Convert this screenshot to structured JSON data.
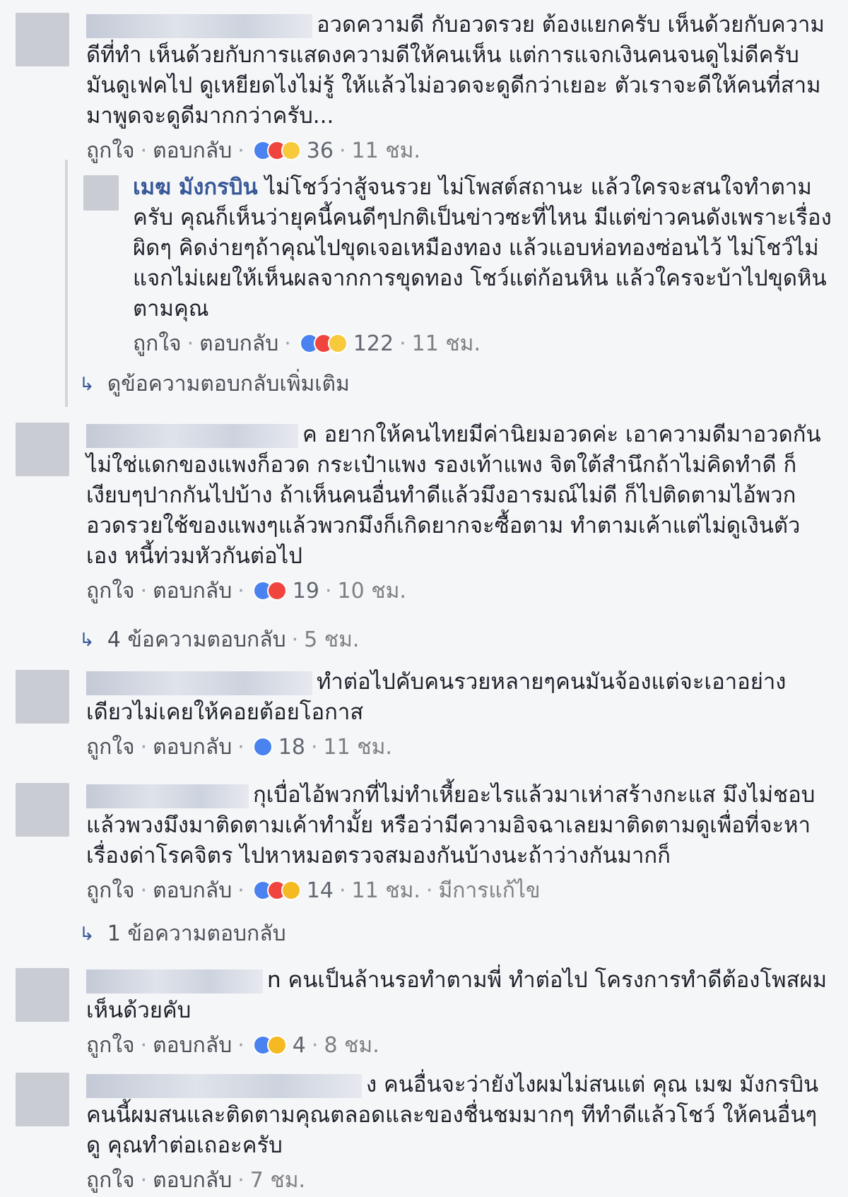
{
  "labels": {
    "like": "ถูกใจ",
    "reply": "ตอบกลับ",
    "separator": "·"
  },
  "comments": [
    {
      "author_visible": "",
      "text": "อวดความดี กับอวดรวย ต้องแยกครับ เห็นด้วยกับความดีที่ทำ เห็นด้วยกับการแสดงความดีให้คนเห็น แต่การแจกเงินคนจนดูไม่ดีครับ มันดูเฟคไป ดูเหยียดไงไม่รู้ ให้แล้วไม่อวดจะดูดีกว่าเยอะ ตัวเราจะดีให้คนที่สามมาพูดจะดูดีมากกว่าครับ...",
      "reaction_count": "36",
      "time": "11 ชม.",
      "reactions": [
        "like",
        "love",
        "haha"
      ]
    },
    {
      "author_visible": "เมฆ มังกรบิน",
      "text": "ไม่โชว์ว่าสู้จนรวย ไม่โพสต์สถานะ แล้วใครจะสนใจทำตามครับ คุณก็เห็นว่ายุคนี้คนดีๆปกติเป็นข่าวซะที่ไหน มีแต่ข่าวคนดังเพราะเรื่องผิดๆ คิดง่ายๆถ้าคุณไปขุดเจอเหมืองทอง แล้วแอบห่อทองซ่อนไว้ ไม่โชว์ไม่แจกไม่เผยให้เห็นผลจากการขุดทอง โชว์แต่ก้อนหิน แล้วใครจะบ้าไปขุดหินตามคุณ",
      "reaction_count": "122",
      "time": "11 ชม.",
      "reactions": [
        "like",
        "love",
        "haha"
      ]
    },
    {
      "author_visible": "",
      "text": "ค อยากให้คนไทยมีค่านิยมอวดค่ะ เอาความดีมาอวดกัน ไม่ใช่แดกของแพงก็อวด กระเป๋าแพง รองเท้าแพง จิตใต้สำนึกถ้าไม่คิดทำดี ก็เงียบๆปากกันไปบ้าง ถ้าเห็นคนอื่นทำดีแล้วมึงอารมณ์ไม่ดี ก็ไปติดตามไอ้พวกอวดรวยใช้ของแพงๆแล้วพวกมึงก็เกิดยากจะซื้อตาม ทำตามเค้าแต่ไม่ดูเงินตัวเอง หนี้ท่วมหัวกันต่อไป",
      "reaction_count": "19",
      "time": "10 ชม.",
      "reactions": [
        "like",
        "love"
      ]
    },
    {
      "author_visible": "",
      "text": "ทำต่อไปคับคนรวยหลายๆคนมันจ้องแต่จะเอาอย่างเดียวไม่เคยให้คอยต้อยโอกาส",
      "reaction_count": "18",
      "time": "11 ชม.",
      "reactions": [
        "like"
      ]
    },
    {
      "author_visible": "",
      "text": "กุเบื่อไอ้พวกที่ไม่ทำเหี้ยอะไรแล้วมาเห่าสร้างกะแส มึงไม่ชอบแล้วพวงมึงมาติดตามเค้าทำมั้ย หรือว่ามีความอิจฉาเลยมาติดตามดูเพื่อที่จะหาเรื่องด่าโรคจิตร ไปหาหมอตรวจสมองกันบ้างนะถ้าว่างกันมากก็",
      "reaction_count": "14",
      "time": "11 ชม.",
      "edited": "มีการแก้ไข",
      "reactions": [
        "like",
        "love",
        "wow"
      ]
    },
    {
      "author_visible": "",
      "text": "n คนเป็นล้านรอทำตามพี่ ทำต่อไป โครงการทำดีต้องโพสผมเห็นด้วยคับ",
      "reaction_count": "4",
      "time": "8 ชม.",
      "reactions": [
        "like",
        "wow"
      ]
    },
    {
      "author_visible": "",
      "text": "ง คนอื่นจะว่ายังไงผมไม่สนแต่ คุณ เมฆ มังกรบิน คนนี้ผมสนและติดตามคุณตลอดและของชื่นชมมากๆ ทีทำดีแล้วโชว์ ให้คนอื่นๆดู คุณทำต่อเถอะครับ",
      "time": "7 ชม."
    }
  ],
  "more_replies": [
    {
      "text": "ดูข้อความตอบกลับเพิ่มเติม",
      "time": ""
    },
    {
      "text": "4 ข้อความตอบกลับ",
      "time": "5 ชม."
    },
    {
      "text": "1 ข้อความตอบกลับ",
      "time": ""
    }
  ]
}
